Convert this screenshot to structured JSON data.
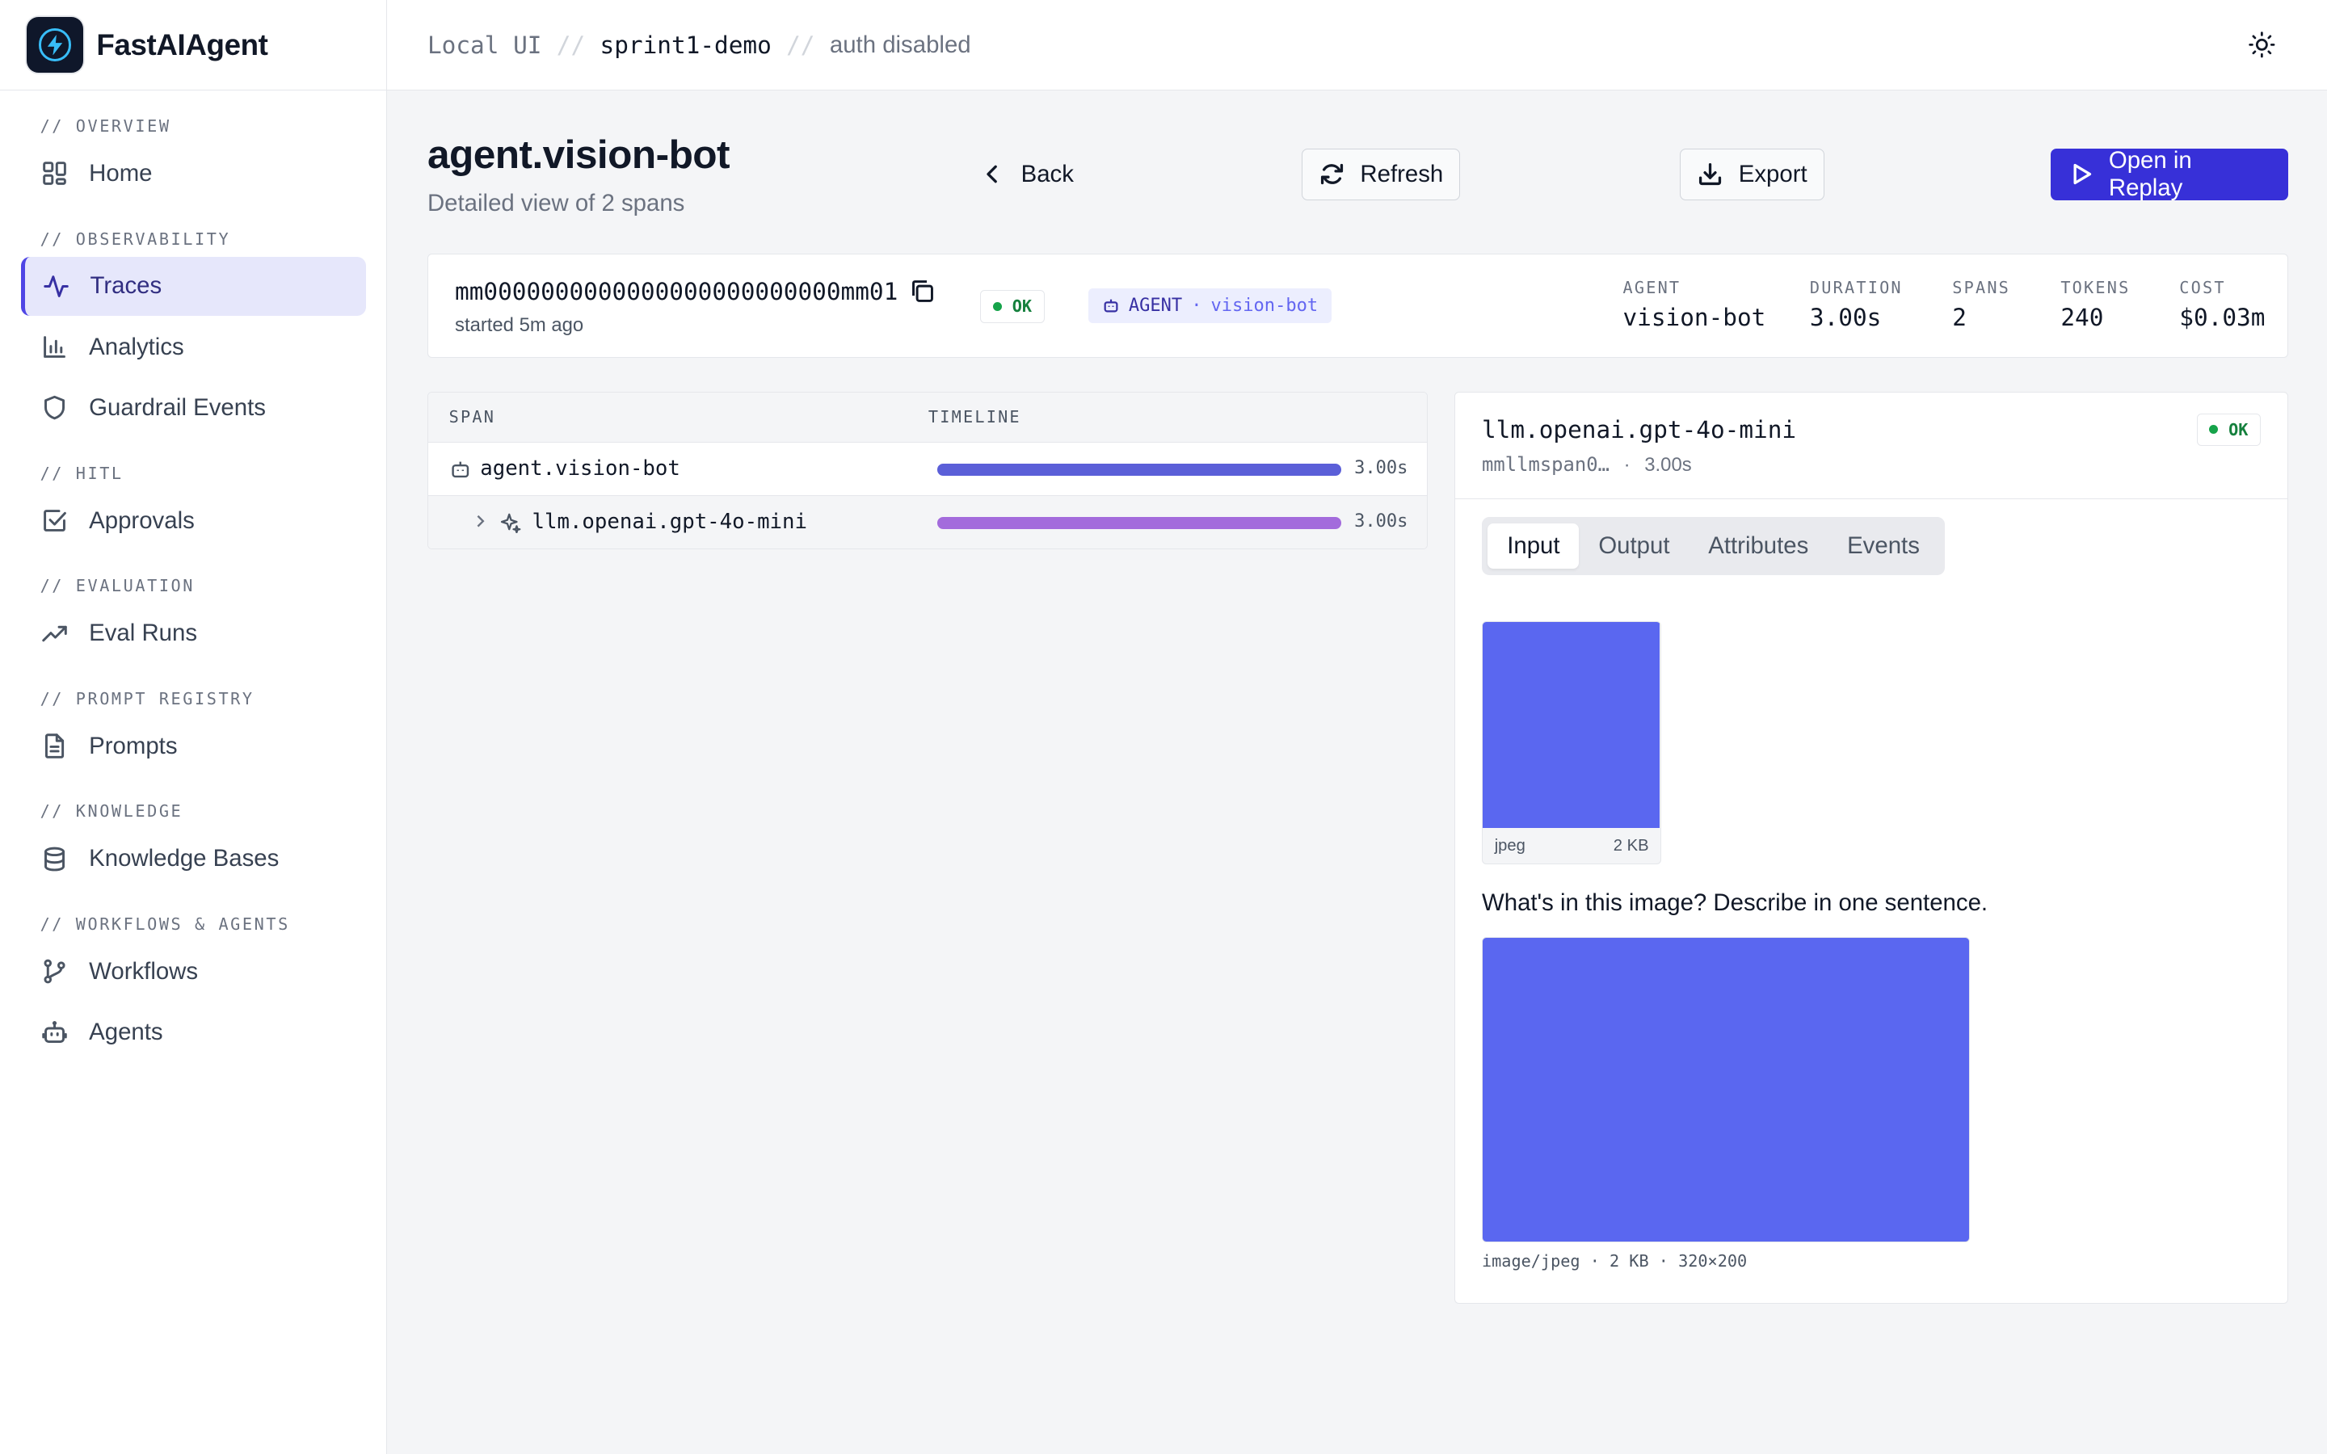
{
  "app": {
    "name": "FastAIAgent"
  },
  "breadcrumb": {
    "part1": "Local UI",
    "sep": "//",
    "part2": "sprint1-demo",
    "part3": "auth disabled"
  },
  "sidebar": {
    "sections": [
      {
        "label": "// OVERVIEW",
        "items": [
          {
            "label": "Home",
            "icon": "grid-icon"
          }
        ]
      },
      {
        "label": "// OBSERVABILITY",
        "items": [
          {
            "label": "Traces",
            "icon": "activity-icon",
            "active": true
          },
          {
            "label": "Analytics",
            "icon": "bar-chart-icon"
          },
          {
            "label": "Guardrail Events",
            "icon": "shield-icon"
          }
        ]
      },
      {
        "label": "// HITL",
        "items": [
          {
            "label": "Approvals",
            "icon": "check-square-icon"
          }
        ]
      },
      {
        "label": "// EVALUATION",
        "items": [
          {
            "label": "Eval Runs",
            "icon": "trending-up-icon"
          }
        ]
      },
      {
        "label": "// PROMPT REGISTRY",
        "items": [
          {
            "label": "Prompts",
            "icon": "file-text-icon"
          }
        ]
      },
      {
        "label": "// KNOWLEDGE",
        "items": [
          {
            "label": "Knowledge Bases",
            "icon": "database-icon"
          }
        ]
      },
      {
        "label": "// WORKFLOWS & AGENTS",
        "items": [
          {
            "label": "Workflows",
            "icon": "git-branch-icon"
          },
          {
            "label": "Agents",
            "icon": "bot-icon"
          }
        ]
      }
    ]
  },
  "header": {
    "title": "agent.vision-bot",
    "subtitle": "Detailed view of 2 spans",
    "back_label": "Back",
    "refresh_label": "Refresh",
    "export_label": "Export",
    "replay_label": "Open in Replay"
  },
  "summary": {
    "trace_id": "mm0000000000000000000000000mm01",
    "started": "started 5m ago",
    "status": "OK",
    "kind": "AGENT",
    "kind_sep": "·",
    "kind_name": "vision-bot",
    "stats": [
      {
        "label": "AGENT",
        "value": "vision-bot"
      },
      {
        "label": "DURATION",
        "value": "3.00s"
      },
      {
        "label": "SPANS",
        "value": "2"
      },
      {
        "label": "TOKENS",
        "value": "240"
      },
      {
        "label": "COST",
        "value": "$0.03m"
      }
    ]
  },
  "span_tree": {
    "columns": {
      "span": "SPAN",
      "timeline": "TIMELINE"
    },
    "rows": [
      {
        "name": "agent.vision-bot",
        "duration": "3.00s",
        "fraction": 1.0,
        "color": "#5b5fd8"
      },
      {
        "name": "llm.openai.gpt-4o-mini",
        "duration": "3.00s",
        "fraction": 1.0,
        "color": "#a36bdc"
      }
    ]
  },
  "detail": {
    "title": "llm.openai.gpt-4o-mini",
    "span_id": "mmllmspan0…",
    "meta_sep": "·",
    "duration": "3.00s",
    "status": "OK",
    "tabs": [
      "Input",
      "Output",
      "Attributes",
      "Events"
    ],
    "active_tab": "Input",
    "thumb": {
      "format": "jpeg",
      "size": "2 KB",
      "color": "#5a67f0"
    },
    "prompt": "What's in this image? Describe in one sentence.",
    "image_meta": "image/jpeg · 2 KB · 320×200"
  }
}
